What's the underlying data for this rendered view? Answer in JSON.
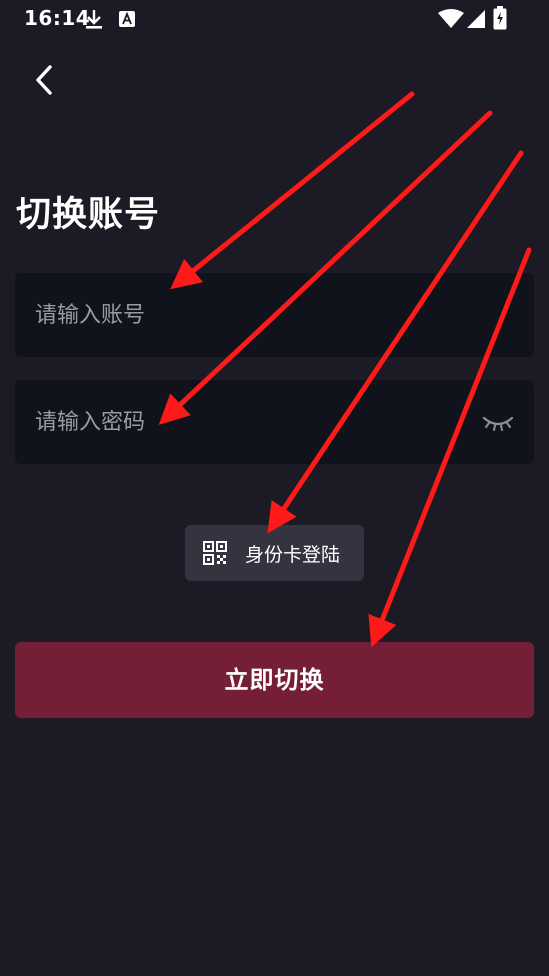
{
  "status_bar": {
    "time": "16:14",
    "icons": [
      "download-icon",
      "a-badge-icon",
      "wifi-icon",
      "signal-icon",
      "battery-icon"
    ]
  },
  "header": {
    "back_icon": "chevron-left-icon"
  },
  "page_title": "切换账号",
  "account_field": {
    "placeholder": "请输入账号",
    "value": ""
  },
  "password_field": {
    "placeholder": "请输入密码",
    "value": "",
    "toggle_icon": "eye-closed-icon"
  },
  "id_card_login": {
    "icon": "qr-code-icon",
    "label": "身份卡登陆"
  },
  "submit_button": {
    "label": "立即切换"
  },
  "colors": {
    "background": "#1b1a25",
    "field_background": "#11131c",
    "secondary_button": "#343440",
    "primary_button": "#751f37",
    "annotation_arrow": "#ff1a1a"
  }
}
